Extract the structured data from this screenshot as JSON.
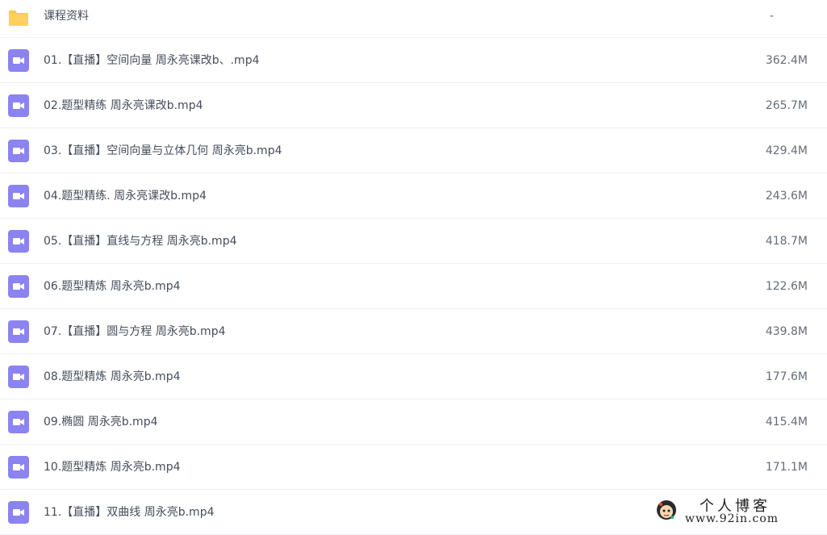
{
  "folder": {
    "name": "课程资料",
    "size": "-",
    "icon": "folder-icon",
    "color": "#fcc84a"
  },
  "files": [
    {
      "name": "01.【直播】空间向量 周永亮课改b、.mp4",
      "size": "362.4M",
      "icon": "video-file-icon"
    },
    {
      "name": "02.题型精练 周永亮课改b.mp4",
      "size": "265.7M",
      "icon": "video-file-icon"
    },
    {
      "name": "03.【直播】空间向量与立体几何 周永亮b.mp4",
      "size": "429.4M",
      "icon": "video-file-icon"
    },
    {
      "name": "04.题型精练. 周永亮课改b.mp4",
      "size": "243.6M",
      "icon": "video-file-icon"
    },
    {
      "name": "05.【直播】直线与方程 周永亮b.mp4",
      "size": "418.7M",
      "icon": "video-file-icon"
    },
    {
      "name": "06.题型精炼 周永亮b.mp4",
      "size": "122.6M",
      "icon": "video-file-icon"
    },
    {
      "name": "07.【直播】圆与方程 周永亮b.mp4",
      "size": "439.8M",
      "icon": "video-file-icon"
    },
    {
      "name": "08.题型精炼 周永亮b.mp4",
      "size": "177.6M",
      "icon": "video-file-icon"
    },
    {
      "name": "09.椭圆 周永亮b.mp4",
      "size": "415.4M",
      "icon": "video-file-icon"
    },
    {
      "name": "10.题型精炼 周永亮b.mp4",
      "size": "171.1M",
      "icon": "video-file-icon"
    },
    {
      "name": "11.【直播】双曲线 周永亮b.mp4",
      "size": "",
      "icon": "video-file-icon"
    }
  ],
  "video_icon_color": "#8b83f0",
  "watermark": {
    "title": "个人博客",
    "url": "www.92in.com"
  }
}
